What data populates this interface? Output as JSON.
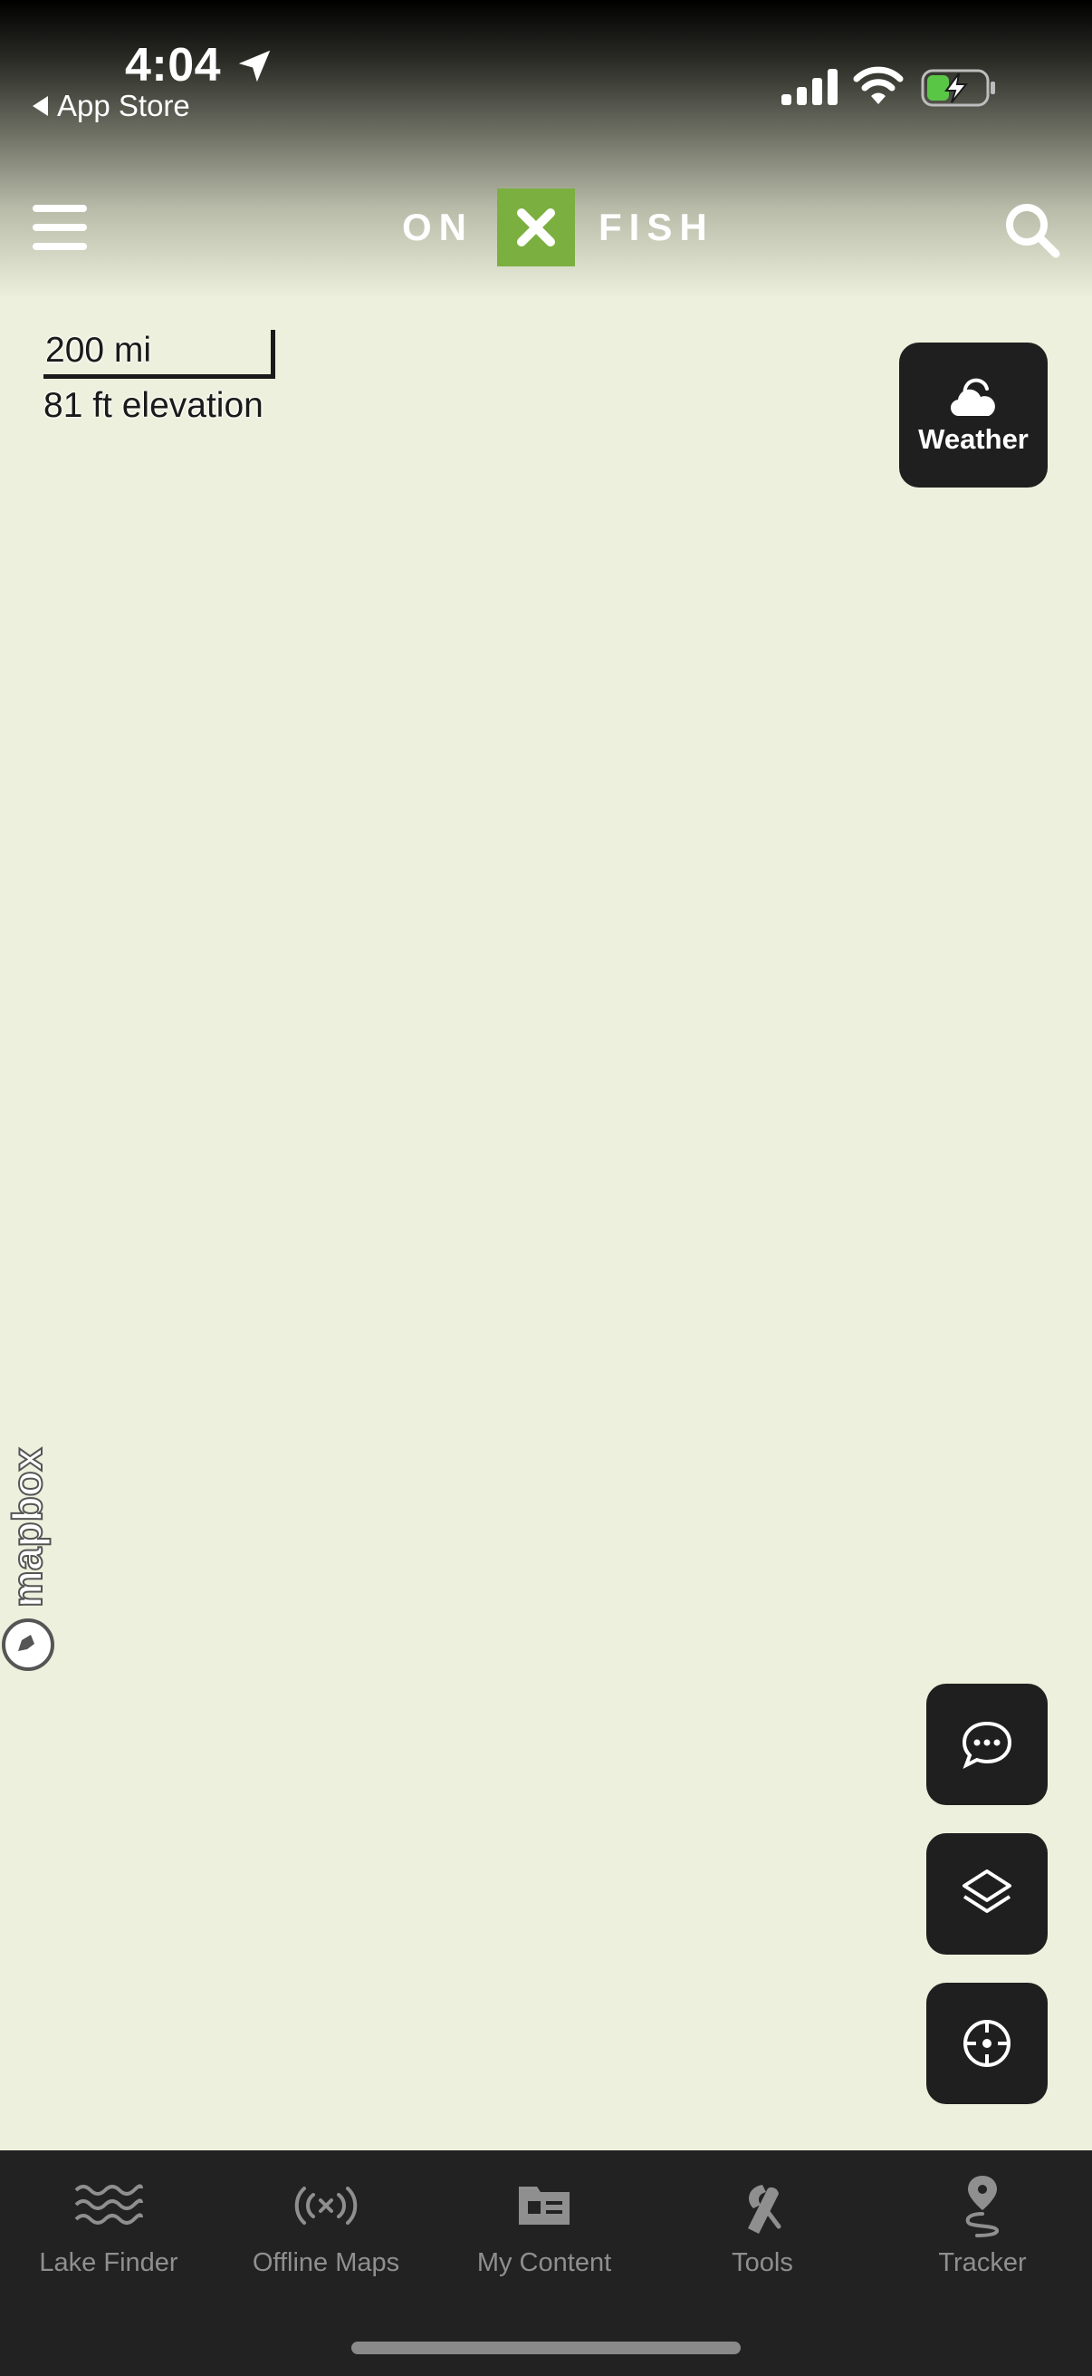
{
  "status_bar": {
    "time": "4:04",
    "back_label": "App Store"
  },
  "header": {
    "logo_left": "ON",
    "logo_mark": "✕",
    "logo_right": "FISH"
  },
  "map": {
    "scale_distance": "200 mi",
    "elevation": "81 ft elevation",
    "attribution": "mapbox"
  },
  "weather": {
    "label": "Weather"
  },
  "tabs": [
    {
      "label": "Lake Finder",
      "icon": "waves-icon"
    },
    {
      "label": "Offline Maps",
      "icon": "offline-broadcast-icon"
    },
    {
      "label": "My Content",
      "icon": "folder-icon"
    },
    {
      "label": "Tools",
      "icon": "tools-icon"
    },
    {
      "label": "Tracker",
      "icon": "route-pin-icon"
    }
  ],
  "colors": {
    "map_background": "#edf0dc",
    "brand_green": "#7bb040",
    "button_dark": "#1f1f1f",
    "tabbar": "#222222",
    "tab_label": "#8f8f8f"
  }
}
